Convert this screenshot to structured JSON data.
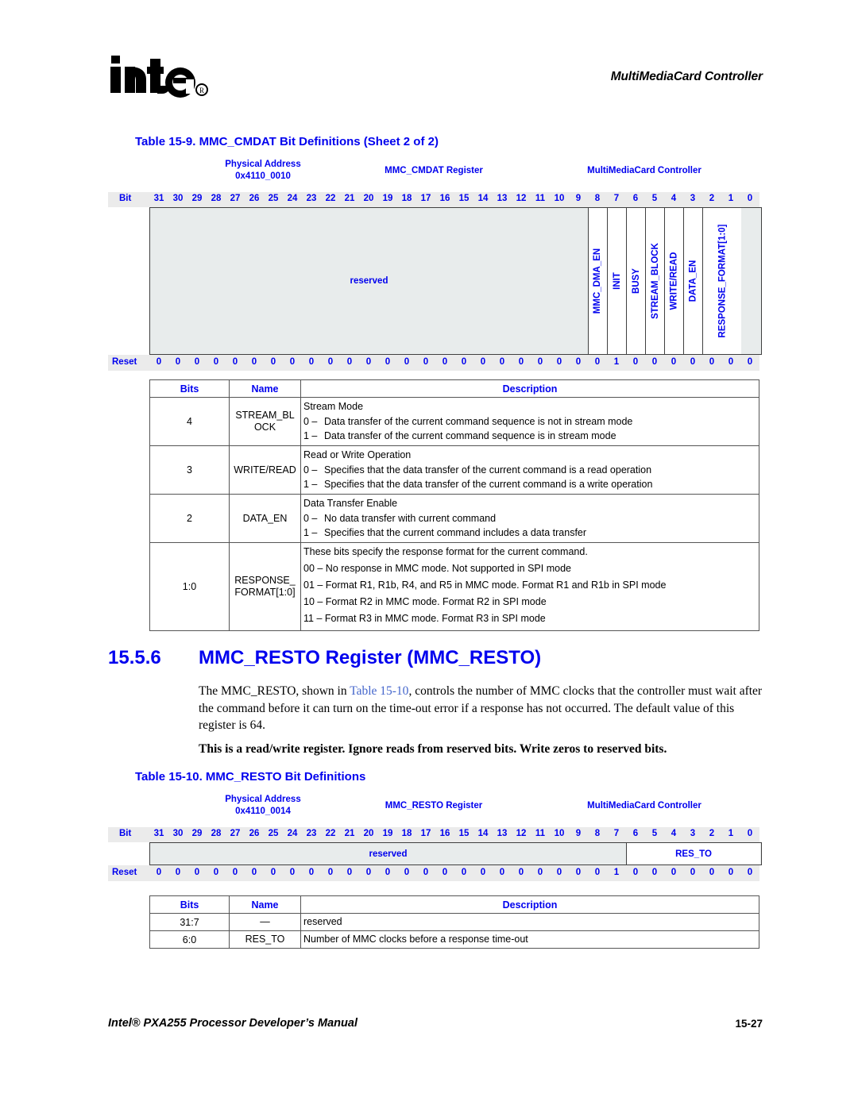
{
  "header": {
    "logo_alt": "intel-logo",
    "chapter_title": "MultiMediaCard Controller"
  },
  "table1": {
    "caption": "Table 15-9. MMC_CMDAT Bit Definitions (Sheet 2 of 2)",
    "diagram": {
      "physical_address_label": "Physical Address",
      "physical_address_value": "0x4110_0010",
      "register_label": "MMC_CMDAT Register",
      "unit_label": "MultiMediaCard Controller",
      "bit_word": "Bit",
      "reset_word": "Reset",
      "bit_numbers": [
        "31",
        "30",
        "29",
        "28",
        "27",
        "26",
        "25",
        "24",
        "23",
        "22",
        "21",
        "20",
        "19",
        "18",
        "17",
        "16",
        "15",
        "14",
        "13",
        "12",
        "11",
        "10",
        "9",
        "8",
        "7",
        "6",
        "5",
        "4",
        "3",
        "2",
        "1",
        "0"
      ],
      "reset_values": [
        "0",
        "0",
        "0",
        "0",
        "0",
        "0",
        "0",
        "0",
        "0",
        "0",
        "0",
        "0",
        "0",
        "0",
        "0",
        "0",
        "0",
        "0",
        "0",
        "0",
        "0",
        "0",
        "0",
        "0",
        "1",
        "0",
        "0",
        "0",
        "0",
        "0",
        "0",
        "0"
      ],
      "fields": [
        {
          "name": "reserved",
          "bits": 23,
          "orient": "h",
          "shaded": true
        },
        {
          "name": "MMC_DMA_EN",
          "bits": 1,
          "orient": "v",
          "shaded": false
        },
        {
          "name": "INIT",
          "bits": 1,
          "orient": "v",
          "shaded": false
        },
        {
          "name": "BUSY",
          "bits": 1,
          "orient": "v",
          "shaded": false
        },
        {
          "name": "STREAM_BLOCK",
          "bits": 1,
          "orient": "v",
          "shaded": false
        },
        {
          "name": "WRITE/READ",
          "bits": 1,
          "orient": "v",
          "shaded": false
        },
        {
          "name": "DATA_EN",
          "bits": 1,
          "orient": "v",
          "shaded": false
        },
        {
          "name": "RESPONSE_FORMAT[1:0]",
          "bits": 2,
          "orient": "v",
          "shaded": false
        }
      ]
    },
    "columns": {
      "bits": "Bits",
      "name": "Name",
      "description": "Description"
    },
    "rows": [
      {
        "bits": "4",
        "name": "STREAM_BLOCK",
        "desc_head": "Stream Mode",
        "options": [
          {
            "key": "0 –",
            "text": "Data transfer of the current command sequence is not in stream mode"
          },
          {
            "key": "1 –",
            "text": "Data transfer of the current command sequence is in stream mode"
          }
        ]
      },
      {
        "bits": "3",
        "name": "WRITE/READ",
        "desc_head": "Read or Write Operation",
        "options": [
          {
            "key": "0 –",
            "text": "Specifies that the data transfer of the current command is a read operation"
          },
          {
            "key": "1 –",
            "text": "Specifies that the data transfer of the current command is a write operation"
          }
        ]
      },
      {
        "bits": "2",
        "name": "DATA_EN",
        "desc_head": "Data Transfer Enable",
        "options": [
          {
            "key": "0 –",
            "text": "No data transfer with current command"
          },
          {
            "key": "1 –",
            "text": "Specifies that the current command includes a data transfer"
          }
        ]
      }
    ],
    "response_row": {
      "bits": "1:0",
      "name_line1": "RESPONSE_",
      "name_line2": "FORMAT[1:0]",
      "desc_head": "These bits specify the response format for the current command.",
      "lines": [
        "00 – No response in MMC mode. Not supported in SPI mode",
        "01 – Format R1, R1b, R4, and R5 in MMC mode. Format R1 and R1b in SPI mode",
        "10 – Format R2 in MMC mode. Format R2 in SPI mode",
        "11 – Format R3 in MMC mode. Format R3 in SPI mode"
      ]
    }
  },
  "section": {
    "number": "15.5.6",
    "title": "MMC_RESTO Register (MMC_RESTO)",
    "paragraph_pre": "The MMC_RESTO, shown in ",
    "paragraph_link": "Table 15-10",
    "paragraph_post": ", controls the number of MMC clocks that the controller must wait after the command before it can turn on the time-out error if a response has not occurred. The default value of this register is 64.",
    "note": "This is a read/write register. Ignore reads from reserved bits. Write zeros to reserved bits."
  },
  "table2": {
    "caption": "Table 15-10. MMC_RESTO Bit Definitions",
    "diagram": {
      "physical_address_label": "Physical Address",
      "physical_address_value": "0x4110_0014",
      "register_label": "MMC_RESTO Register",
      "unit_label": "MultiMediaCard Controller",
      "bit_word": "Bit",
      "reset_word": "Reset",
      "bit_numbers": [
        "31",
        "30",
        "29",
        "28",
        "27",
        "26",
        "25",
        "24",
        "23",
        "22",
        "21",
        "20",
        "19",
        "18",
        "17",
        "16",
        "15",
        "14",
        "13",
        "12",
        "11",
        "10",
        "9",
        "8",
        "7",
        "6",
        "5",
        "4",
        "3",
        "2",
        "1",
        "0"
      ],
      "reset_values": [
        "0",
        "0",
        "0",
        "0",
        "0",
        "0",
        "0",
        "0",
        "0",
        "0",
        "0",
        "0",
        "0",
        "0",
        "0",
        "0",
        "0",
        "0",
        "0",
        "0",
        "0",
        "0",
        "0",
        "0",
        "1",
        "0",
        "0",
        "0",
        "0",
        "0",
        "0",
        "0"
      ],
      "fields": [
        {
          "name": "reserved",
          "bits": 25,
          "orient": "h",
          "shaded": true
        },
        {
          "name": "RES_TO",
          "bits": 7,
          "orient": "h",
          "shaded": false
        }
      ]
    },
    "columns": {
      "bits": "Bits",
      "name": "Name",
      "description": "Description"
    },
    "rows": [
      {
        "bits": "31:7",
        "name": "—",
        "desc": "reserved"
      },
      {
        "bits": "6:0",
        "name": "RES_TO",
        "desc": "Number of MMC clocks before a response time-out"
      }
    ]
  },
  "footer": {
    "left": "Intel® PXA255 Processor Developer’s Manual",
    "right": "15-27"
  }
}
